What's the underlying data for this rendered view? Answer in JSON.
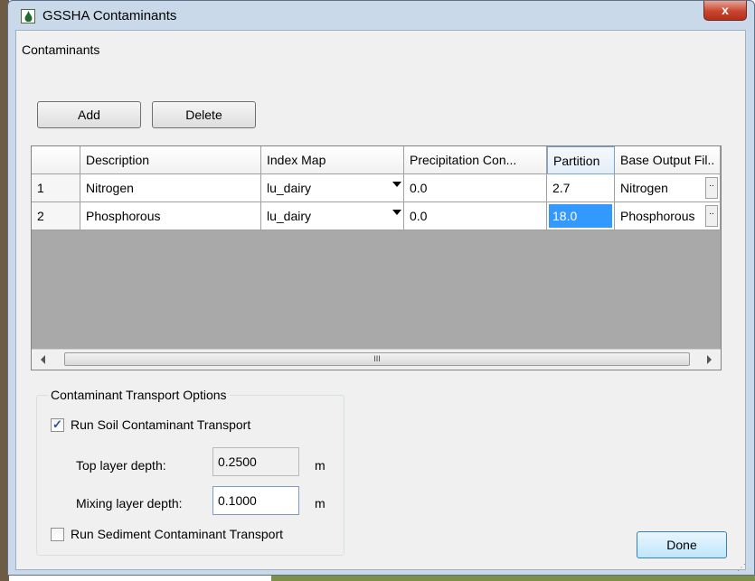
{
  "window": {
    "title": "GSSHA Contaminants",
    "close_label": "x"
  },
  "contaminants": {
    "section_label": "Contaminants",
    "add_label": "Add",
    "delete_label": "Delete"
  },
  "grid": {
    "columns": [
      "",
      "Description",
      "Index Map",
      "Precipitation Con...",
      "Partition",
      "Base Output Fil.."
    ],
    "rows": [
      {
        "num": "1",
        "description": "Nitrogen",
        "index_map": "lu_dairy",
        "precip": "0.0",
        "partition": "2.7",
        "base_output": "Nitrogen",
        "ellipsis": ".."
      },
      {
        "num": "2",
        "description": "Phosphorous",
        "index_map": "lu_dairy",
        "precip": "0.0",
        "partition": "18.0",
        "base_output": "Phosphorous",
        "ellipsis": ".."
      }
    ],
    "scroll_grip": "III"
  },
  "transport": {
    "group_title": "Contaminant Transport Options",
    "soil_label": "Run Soil Contaminant Transport",
    "soil_checked": true,
    "top_layer_label": "Top layer depth:",
    "top_layer_value": "0.2500",
    "top_layer_unit": "m",
    "mixing_layer_label": "Mixing layer depth:",
    "mixing_layer_value": "0.1000",
    "mixing_layer_unit": "m",
    "sediment_label": "Run Sediment Contaminant Transport",
    "sediment_checked": false
  },
  "done_label": "Done",
  "colors": {
    "selection": "#3399ff",
    "title_bar": "#c9d9ea",
    "close_button": "#c8452f"
  }
}
